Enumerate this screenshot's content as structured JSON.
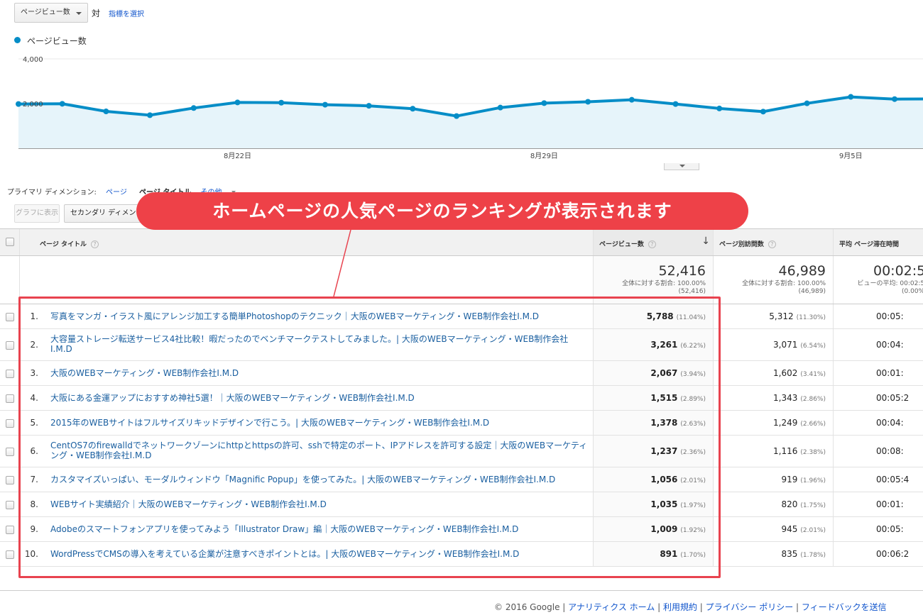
{
  "controls": {
    "metric_select": "ページビュー数",
    "vs_label": "対",
    "choose_metric": "指標を選択"
  },
  "chart_data": {
    "type": "area",
    "series": [
      {
        "name": "ページビュー数",
        "color": "#058dc7",
        "values": [
          1980,
          1990,
          1650,
          1480,
          1800,
          2050,
          2040,
          1950,
          1900,
          1770,
          1440,
          1820,
          2020,
          2080,
          2170,
          1980,
          1780,
          1640,
          2010,
          2300,
          2200,
          2210
        ]
      }
    ],
    "x": [
      "8月17日",
      "8月18日",
      "8月19日",
      "8月20日",
      "8月21日",
      "8月22日",
      "8月23日",
      "8月24日",
      "8月25日",
      "8月26日",
      "8月27日",
      "8月28日",
      "8月29日",
      "8月30日",
      "8月31日",
      "9月1日",
      "9月2日",
      "9月3日",
      "9月4日",
      "9月5日",
      "9月6日",
      "9月7日"
    ],
    "x_tick_labels": [
      "8月22日",
      "8月29日",
      "9月5日"
    ],
    "y_tick_labels": [
      "4,000",
      "2,000"
    ],
    "ylim": [
      0,
      4000
    ],
    "grid": true,
    "legend": "top-left"
  },
  "primary_dimension": {
    "label": "プライマリ ディメンション:",
    "options": [
      "ページ",
      "ページ タイトル",
      "その他"
    ],
    "selected": "ページ タイトル"
  },
  "buttons": {
    "graph": "グラフに表示",
    "secondary_dimension": "セカンダリ ディメンション"
  },
  "table": {
    "headers": {
      "title": "ページ タイトル",
      "pageviews": "ページビュー数",
      "unique": "ページ別訪問数",
      "avg_time": "平均 ページ滞在時間"
    },
    "totals": {
      "pageviews": "52,416",
      "pageviews_sub1": "全体に対する割合: 100.00%",
      "pageviews_sub2": "(52,416)",
      "unique": "46,989",
      "unique_sub1": "全体に対する割合: 100.00%",
      "unique_sub2": "(46,989)",
      "avg_time": "00:02:5",
      "avg_time_sub1": "ビューの平均: 00:02:5",
      "avg_time_sub2": "(0.00%"
    },
    "rows": [
      {
        "num": "1.",
        "title": "写真をマンガ・イラスト風にアレンジ加工する簡単Photoshopのテクニック｜大阪のWEBマーケティング・WEB制作会社I.M.D",
        "pv": "5,788",
        "pv_pct": "(11.04%)",
        "uv": "5,312",
        "uv_pct": "(11.30%)",
        "time": "00:05:"
      },
      {
        "num": "2.",
        "title": "大容量ストレージ転送サービス4社比較！暇だったのでベンチマークテストしてみました。| 大阪のWEBマーケティング・WEB制作会社I.M.D",
        "pv": "3,261",
        "pv_pct": "(6.22%)",
        "uv": "3,071",
        "uv_pct": "(6.54%)",
        "time": "00:04:"
      },
      {
        "num": "3.",
        "title": "大阪のWEBマーケティング・WEB制作会社I.M.D",
        "pv": "2,067",
        "pv_pct": "(3.94%)",
        "uv": "1,602",
        "uv_pct": "(3.41%)",
        "time": "00:01:"
      },
      {
        "num": "4.",
        "title": "大阪にある金運アップにおすすめ神社5選！｜大阪のWEBマーケティング・WEB制作会社I.M.D",
        "pv": "1,515",
        "pv_pct": "(2.89%)",
        "uv": "1,343",
        "uv_pct": "(2.86%)",
        "time": "00:05:2"
      },
      {
        "num": "5.",
        "title": "2015年のWEBサイトはフルサイズリキッドデザインで行こう。| 大阪のWEBマーケティング・WEB制作会社I.M.D",
        "pv": "1,378",
        "pv_pct": "(2.63%)",
        "uv": "1,249",
        "uv_pct": "(2.66%)",
        "time": "00:04:"
      },
      {
        "num": "6.",
        "title": "CentOS7のfirewalldでネットワークゾーンにhttpとhttpsの許可、sshで特定のポート、IPアドレスを許可する設定｜大阪のWEBマーケティング・WEB制作会社I.M.D",
        "pv": "1,237",
        "pv_pct": "(2.36%)",
        "uv": "1,116",
        "uv_pct": "(2.38%)",
        "time": "00:08:"
      },
      {
        "num": "7.",
        "title": "カスタマイズいっぱい、モーダルウィンドウ「Magnific Popup」を使ってみた。| 大阪のWEBマーケティング・WEB制作会社I.M.D",
        "pv": "1,056",
        "pv_pct": "(2.01%)",
        "uv": "919",
        "uv_pct": "(1.96%)",
        "time": "00:05:4"
      },
      {
        "num": "8.",
        "title": "WEBサイト実績紹介｜大阪のWEBマーケティング・WEB制作会社I.M.D",
        "pv": "1,035",
        "pv_pct": "(1.97%)",
        "uv": "820",
        "uv_pct": "(1.75%)",
        "time": "00:01:"
      },
      {
        "num": "9.",
        "title": "Adobeのスマートフォンアプリを使ってみよう「Illustrator Draw」編｜大阪のWEBマーケティング・WEB制作会社I.M.D",
        "pv": "1,009",
        "pv_pct": "(1.92%)",
        "uv": "945",
        "uv_pct": "(2.01%)",
        "time": "00:05:"
      },
      {
        "num": "10.",
        "title": "WordPressでCMSの導入を考えている企業が注意すべきポイントとは。| 大阪のWEBマーケティング・WEB制作会社I.M.D",
        "pv": "891",
        "pv_pct": "(1.70%)",
        "uv": "835",
        "uv_pct": "(1.78%)",
        "time": "00:06:2"
      }
    ]
  },
  "annotation": {
    "callout": "ホームページの人気ページのランキングが表示されます",
    "color": "#ee4148"
  },
  "footer": {
    "copyright": "© 2016 Google",
    "links": [
      "アナリティクス ホーム",
      "利用規約",
      "プライバシー ポリシー",
      "フィードバックを送信"
    ]
  }
}
